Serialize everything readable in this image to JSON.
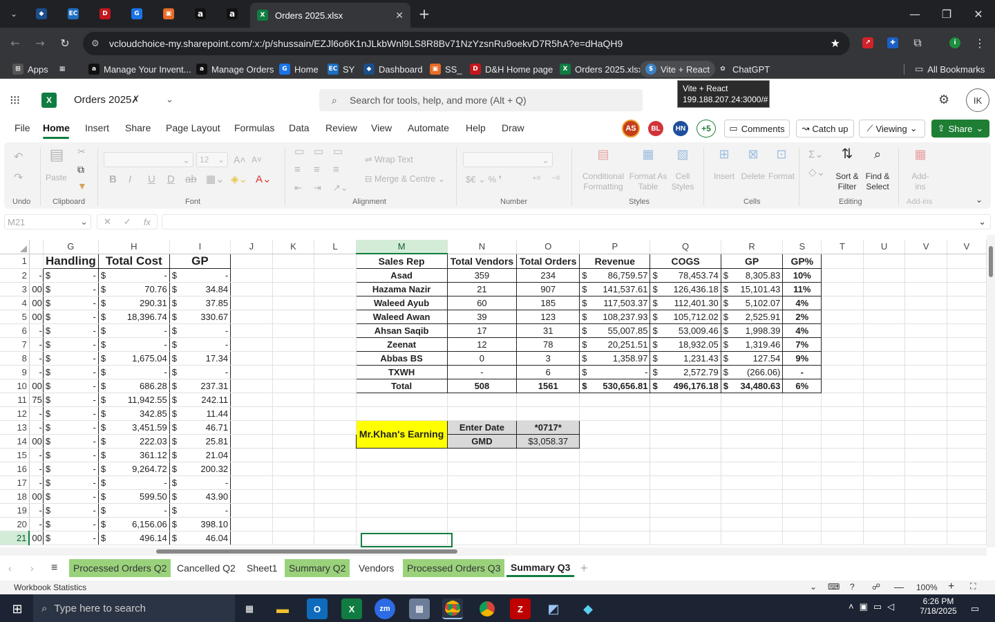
{
  "browser": {
    "active_tab_title": "Orders 2025.xlsx",
    "url": "vcloudchoice-my.sharepoint.com/:x:/p/shussain/EZJl6o6K1nJLkbWnl9LS8R8Bv71NzYzsnRu9oekvD7R5hA?e=dHaQH9",
    "bookmarks": [
      "Apps",
      "Manage Your Invent...",
      "Manage Orders",
      "Home",
      "SY",
      "Dashboard",
      "SS_",
      "D&H Home page",
      "Orders 2025.xlsx",
      "Vite + React",
      "ChatGPT",
      "All Bookmarks"
    ],
    "tooltip_title": "Vite + React",
    "tooltip_url": "199.188.207.24:3000/#"
  },
  "excel": {
    "file_name": "Orders 2025",
    "search_placeholder": "Search for tools, help, and more (Alt + Q)",
    "avatar_initials": "IK",
    "menu": [
      "File",
      "Home",
      "Insert",
      "Share",
      "Page Layout",
      "Formulas",
      "Data",
      "Review",
      "View",
      "Automate",
      "Help",
      "Draw"
    ],
    "collaborators": [
      "AS",
      "BL",
      "HN",
      "+5"
    ],
    "comments_label": "Comments",
    "catchup_label": "Catch up",
    "viewing_label": "Viewing",
    "share_label": "Share",
    "ribbon": {
      "undo_group": "Undo",
      "paste": "Paste",
      "clipboard": "Clipboard",
      "font_size": "12",
      "font_group": "Font",
      "wrap_text": "Wrap Text",
      "merge_centre": "Merge & Centre",
      "alignment": "Alignment",
      "number": "Number",
      "number_symbols": "$€ ⌄  %  ❜",
      "cond_format": "Conditional Formatting",
      "format_as_table": "Format As Table",
      "cell_styles": "Cell Styles",
      "styles": "Styles",
      "insert": "Insert",
      "delete": "Delete",
      "format": "Format",
      "cells": "Cells",
      "sort_filter": "Sort & Filter",
      "find_select": "Find & Select",
      "editing": "Editing",
      "addins": "Add-ins",
      "addins_group": "Add-ins"
    },
    "name_box": "M21",
    "columns": [
      "G",
      "H",
      "I",
      "J",
      "K",
      "L",
      "M",
      "N",
      "O",
      "P",
      "Q",
      "R",
      "S",
      "T",
      "U",
      "V",
      "V"
    ],
    "left_headers": [
      "Handling",
      "Total Cost",
      "GP"
    ],
    "left_rows": [
      [
        "-",
        "-",
        "-",
        "-"
      ],
      [
        "00",
        "-",
        "70.76",
        "34.84"
      ],
      [
        "00",
        "-",
        "290.31",
        "37.85"
      ],
      [
        "00",
        "-",
        "18,396.74",
        "330.67"
      ],
      [
        "-",
        "-",
        "-",
        "-"
      ],
      [
        "-",
        "-",
        "-",
        "-"
      ],
      [
        "-",
        "-",
        "1,675.04",
        "17.34"
      ],
      [
        "-",
        "-",
        "-",
        "-"
      ],
      [
        "00",
        "-",
        "686.28",
        "237.31"
      ],
      [
        "75",
        "-",
        "11,942.55",
        "242.11"
      ],
      [
        "-",
        "-",
        "342.85",
        "11.44"
      ],
      [
        "-",
        "-",
        "3,451.59",
        "46.71"
      ],
      [
        "00",
        "-",
        "222.03",
        "25.81"
      ],
      [
        "-",
        "-",
        "361.12",
        "21.04"
      ],
      [
        "-",
        "-",
        "9,264.72",
        "200.32"
      ],
      [
        "-",
        "-",
        "-",
        "-"
      ],
      [
        "00",
        "-",
        "599.50",
        "43.90"
      ],
      [
        "-",
        "-",
        "-",
        "-"
      ],
      [
        "-",
        "-",
        "6,156.06",
        "398.10"
      ],
      [
        "00",
        "-",
        "496.14",
        "46.04"
      ]
    ],
    "summary_headers": [
      "Sales Rep",
      "Total Vendors",
      "Total Orders",
      "Revenue",
      "COGS",
      "GP",
      "GP%"
    ],
    "summary_rows": [
      [
        "Asad",
        "359",
        "234",
        "86,759.57",
        "78,453.74",
        "8,305.83",
        "10%"
      ],
      [
        "Hazama Nazir",
        "21",
        "907",
        "141,537.61",
        "126,436.18",
        "15,101.43",
        "11%"
      ],
      [
        "Waleed Ayub",
        "60",
        "185",
        "117,503.37",
        "112,401.30",
        "5,102.07",
        "4%"
      ],
      [
        "Waleed Awan",
        "39",
        "123",
        "108,237.93",
        "105,712.02",
        "2,525.91",
        "2%"
      ],
      [
        "Ahsan Saqib",
        "17",
        "31",
        "55,007.85",
        "53,009.46",
        "1,998.39",
        "4%"
      ],
      [
        "Zeenat",
        "12",
        "78",
        "20,251.51",
        "18,932.05",
        "1,319.46",
        "7%"
      ],
      [
        "Abbas BS",
        "0",
        "3",
        "1,358.97",
        "1,231.43",
        "127.54",
        "9%"
      ],
      [
        "TXWH",
        "-",
        "6",
        "-",
        "2,572.79",
        "(266.06)",
        "-"
      ]
    ],
    "summary_total": [
      "Total",
      "508",
      "1561",
      "530,656.81",
      "496,176.18",
      "34,480.63",
      "6%"
    ],
    "currency": "$",
    "earning_label": "Mr.Khan's Earning",
    "enter_date_label": "Enter Date",
    "enter_date_value": "*0717*",
    "gmd_label": "GMD",
    "gmd_value": "$3,058.37",
    "sheets": [
      "Processed Orders Q2",
      "Cancelled Q2",
      "Sheet1",
      "Summary Q2",
      "Vendors",
      "Processed Orders Q3",
      "Summary Q3"
    ],
    "status_text": "Workbook Statistics",
    "zoom": "100%"
  },
  "taskbar": {
    "search_placeholder": "Type here to search",
    "time": "6:26 PM",
    "date": "7/18/2025"
  },
  "colors": {
    "excel_green": "#107c41",
    "share_green": "#1e7e34",
    "tab_green": "#9ad27c",
    "earning_yellow": "#ffff00",
    "header_gray": "#d9d9d9"
  }
}
